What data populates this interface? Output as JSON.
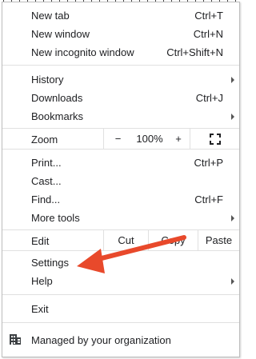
{
  "menu": {
    "groups": [
      [
        {
          "label": "New tab",
          "shortcut": "Ctrl+T"
        },
        {
          "label": "New window",
          "shortcut": "Ctrl+N"
        },
        {
          "label": "New incognito window",
          "shortcut": "Ctrl+Shift+N"
        }
      ],
      [
        {
          "label": "History",
          "submenu": true
        },
        {
          "label": "Downloads",
          "shortcut": "Ctrl+J"
        },
        {
          "label": "Bookmarks",
          "submenu": true
        }
      ]
    ],
    "zoom": {
      "label": "Zoom",
      "minus": "−",
      "value": "100%",
      "plus": "+",
      "fullscreen_icon": "fullscreen-icon"
    },
    "tools": [
      {
        "label": "Print...",
        "shortcut": "Ctrl+P"
      },
      {
        "label": "Cast..."
      },
      {
        "label": "Find...",
        "shortcut": "Ctrl+F"
      },
      {
        "label": "More tools",
        "submenu": true
      }
    ],
    "edit": {
      "label": "Edit",
      "cut": "Cut",
      "copy": "Copy",
      "paste": "Paste"
    },
    "settings": {
      "label": "Settings"
    },
    "help": {
      "label": "Help",
      "submenu": true
    },
    "exit": {
      "label": "Exit"
    },
    "managed": {
      "label": "Managed by your organization",
      "icon": "building-icon"
    }
  },
  "annotation": {
    "color": "#e8492b",
    "icon": "red-pointer-arrow"
  }
}
